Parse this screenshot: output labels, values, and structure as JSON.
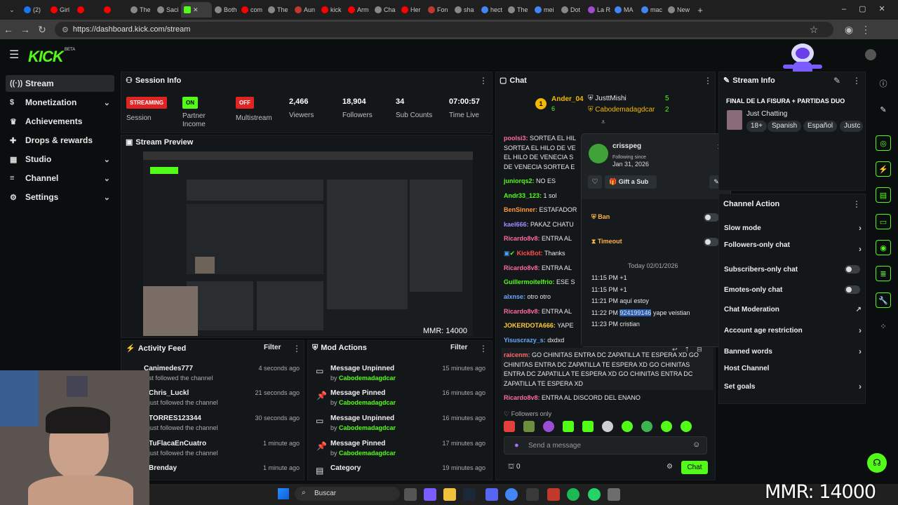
{
  "browser": {
    "tabs": [
      "(2)",
      "Girl",
      "",
      "",
      "The",
      "Saci",
      "",
      "",
      "Both",
      "com",
      "The",
      "Aun",
      "kick",
      "Arm",
      "Cha",
      "Her",
      "Fon",
      "sha",
      "hect",
      "The",
      "mei",
      "Dot",
      "La R",
      "MA",
      "mac",
      "New"
    ],
    "url": "https://dashboard.kick.com/stream",
    "new_tab_icon": "plus-icon"
  },
  "header": {
    "logo": "KICK",
    "beta": "BETA"
  },
  "sidebar": {
    "items": [
      {
        "label": "Stream",
        "icon": "stream-icon",
        "active": true
      },
      {
        "label": "Monetization",
        "icon": "dollar-icon",
        "chevron": true
      },
      {
        "label": "Achievements",
        "icon": "trophy-icon"
      },
      {
        "label": "Drops & rewards",
        "icon": "gift-icon"
      },
      {
        "label": "Studio",
        "icon": "grid-icon",
        "chevron": true
      },
      {
        "label": "Channel",
        "icon": "menu-icon",
        "chevron": true
      },
      {
        "label": "Settings",
        "icon": "gear-icon",
        "chevron": true
      }
    ]
  },
  "session": {
    "title": "Session Info",
    "streaming_badge": "STREAMING",
    "streaming_label": "Session",
    "on_badge": "ON",
    "partner_label": "Partner Income",
    "off_badge": "OFF",
    "multistream_label": "Multistream",
    "viewers": "2,466",
    "viewers_label": "Viewers",
    "followers": "18,904",
    "followers_label": "Followers",
    "subs": "34",
    "subs_label": "Sub Counts",
    "time": "07:00:57",
    "time_label": "Time Live"
  },
  "preview": {
    "title": "Stream Preview",
    "mmr": "MMR: 14000"
  },
  "activity": {
    "title": "Activity Feed",
    "filter": "Filter",
    "items": [
      {
        "name": "Canimedes777",
        "sub": "just followed the channel",
        "time": "4 seconds ago"
      },
      {
        "name": "Chris_Luckl",
        "sub": "just followed the channel",
        "time": "21 seconds ago"
      },
      {
        "name": "TORRES123344",
        "sub": "just followed the channel",
        "time": "30 seconds ago"
      },
      {
        "name": "TuFlacaEnCuatro",
        "sub": "just followed the channel",
        "time": "1 minute ago"
      },
      {
        "name": "Brenday",
        "sub": "just followed the channel",
        "time": "1 minute ago"
      }
    ]
  },
  "mod": {
    "title": "Mod Actions",
    "filter": "Filter",
    "items": [
      {
        "name": "Message Unpinned",
        "by": "Cabodemadagdcar",
        "time": "15 minutes ago",
        "icon": "unpin-icon"
      },
      {
        "name": "Message Pinned",
        "by": "Cabodemadagdcar",
        "time": "16 minutes ago",
        "icon": "pin-icon"
      },
      {
        "name": "Message Unpinned",
        "by": "Cabodemadagdcar",
        "time": "16 minutes ago",
        "icon": "unpin-icon"
      },
      {
        "name": "Message Pinned",
        "by": "Cabodemadagdcar",
        "time": "17 minutes ago",
        "icon": "pin-icon"
      },
      {
        "name": "Category",
        "by": "",
        "time": "19 minutes ago",
        "icon": "category-icon"
      }
    ]
  },
  "chat": {
    "title": "Chat",
    "leaders": [
      {
        "name": "Ander_04",
        "count": "6"
      },
      {
        "name": "JusttMishi",
        "count": "5"
      },
      {
        "name": "Cabodemadagdcar",
        "count": "2"
      }
    ],
    "messages": [
      {
        "user": "poolsi3:",
        "text": "SORTEA EL HIL",
        "color": "#ff6b9e"
      },
      {
        "user": "",
        "text": "SORTEA EL HILO DE VE",
        "color": "#e8e8e8"
      },
      {
        "user": "",
        "text": "EL HILO DE VENECIA S",
        "color": "#e8e8e8"
      },
      {
        "user": "",
        "text": "DE VENECIA SORTEA E",
        "color": "#e8e8e8"
      },
      {
        "user": "juniorqs2:",
        "text": "NO ES",
        "color": "#53fc18"
      },
      {
        "user": "Andr33_123:",
        "text": "1 sol",
        "color": "#53fc18"
      },
      {
        "user": "BenSinner:",
        "text": "ESTAFADOR",
        "color": "#ff9933"
      },
      {
        "user": "kael666:",
        "text": "PAKAZ CHATU",
        "color": "#9e8cff"
      },
      {
        "user": "Ricardo8v8:",
        "text": "ENTRA AL",
        "color": "#ff6b9e"
      },
      {
        "user": "KickBot:",
        "text": "Thanks",
        "color": "#ff4d4d"
      },
      {
        "user": "Ricardo8v8:",
        "text": "ENTRA AL",
        "color": "#ff6b9e"
      },
      {
        "user": "Guillermoitelfrio:",
        "text": "ESE S",
        "color": "#53fc18"
      },
      {
        "user": "alxnse:",
        "text": "otro otro",
        "color": "#6aa8ff"
      },
      {
        "user": "Ricardo8v8:",
        "text": "ENTRA AL",
        "color": "#ff6b9e"
      },
      {
        "user": "JOKERDOTA666:",
        "text": "YAPE",
        "color": "#ffcc33"
      },
      {
        "user": "Yisuscrazy_s:",
        "text": "dxdxd",
        "color": "#6aa8ff"
      }
    ],
    "long_user": "raicenm:",
    "long_text_1": "GO CHINITAS ENTRA DC ZAPATILLA TE ESPERA XD GO",
    "long_text_2": "CHINITAS ENTRA DC ZAPATILLA TE ESPERA XD GO CHINITAS",
    "long_text_3": "ENTRA DC ZAPATILLA TE ESPERA XD GO CHINITAS ENTRA DC",
    "long_text_4": "ZAPATILLA TE ESPERA XD",
    "last_user": "Ricardo8v8:",
    "last_text": "ENTRA AL DISCORD DEL ENANO",
    "followers_only": "Followers only",
    "placeholder": "Send a message",
    "points": "0",
    "send": "Chat"
  },
  "usercard": {
    "name": "crisspeg",
    "following_label": "Following since",
    "following_date": "Jan 31, 2026",
    "gift": "Gift a Sub",
    "ban": "Ban",
    "timeout": "Timeout",
    "today": "Today 02/01/2026",
    "history": [
      {
        "time": "11:15 PM",
        "text": "+1"
      },
      {
        "time": "11:15 PM",
        "text": "+1"
      },
      {
        "time": "11:21 PM",
        "text": "aquí estoy"
      },
      {
        "time": "11:22 PM",
        "text": "924199146 yape veistian",
        "highlight": "924199146"
      },
      {
        "time": "11:23 PM",
        "text": "cristian"
      }
    ]
  },
  "streaminfo": {
    "title": "Stream Info",
    "stream_title": "FINAL DE LA FISURA + PARTIDAS DUO",
    "category": "Just Chatting",
    "tags": [
      "18+",
      "Spanish",
      "Español",
      "Justc"
    ]
  },
  "channel_actions": {
    "title": "Channel Actions",
    "items": [
      {
        "label": "Slow mode",
        "chevron": true
      },
      {
        "label": "Followers-only chat",
        "chevron": true
      },
      {
        "label": "Subscribers-only chat",
        "toggle": true
      },
      {
        "label": "Emotes-only chat",
        "toggle": true
      },
      {
        "label": "Chat Moderation",
        "external": true
      },
      {
        "label": "Account age restriction",
        "chevron": true
      },
      {
        "label": "Banned words",
        "chevron": true
      },
      {
        "label": "Host Channel"
      },
      {
        "label": "Set goals",
        "chevron": true
      }
    ]
  },
  "taskbar": {
    "search": "Buscar"
  },
  "overlay": {
    "mmr": "MMR: 14000"
  },
  "colors": {
    "accent": "#53fc18",
    "live": "#e02424",
    "bg": "#0b0e0f",
    "panel": "#141719"
  }
}
